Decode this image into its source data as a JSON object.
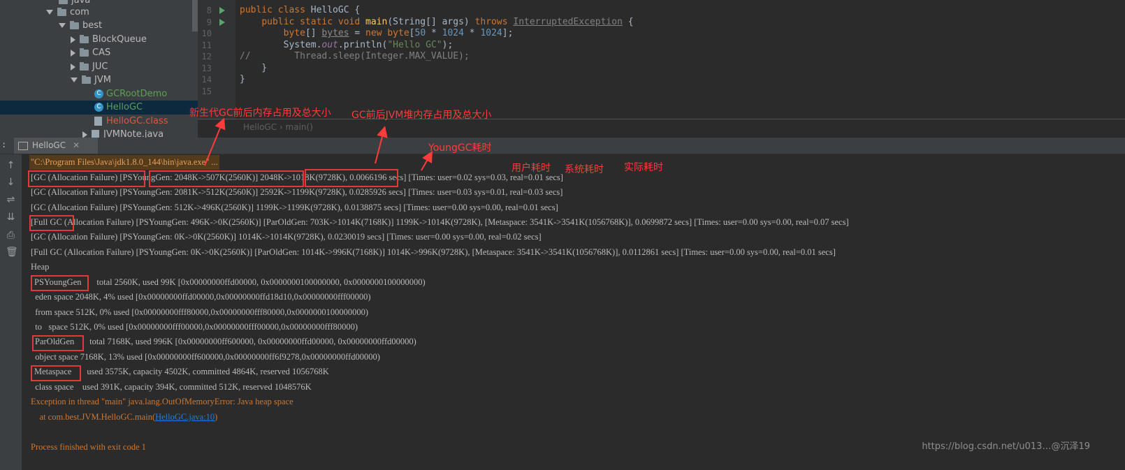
{
  "tree": {
    "items": [
      {
        "label": "java"
      },
      {
        "label": "com"
      },
      {
        "label": "best"
      },
      {
        "label": "BlockQueue"
      },
      {
        "label": "CAS"
      },
      {
        "label": "JUC"
      },
      {
        "label": "JVM"
      },
      {
        "label": "GCRootDemo"
      },
      {
        "label": "HelloGC"
      },
      {
        "label": "HelloGC.class"
      },
      {
        "label": "JVMNote.java"
      }
    ]
  },
  "editor": {
    "line_numbers": [
      "8",
      "9",
      "10",
      "11",
      "12",
      "13",
      "14",
      "15"
    ],
    "breadcrumb": [
      "HelloGC",
      "main()"
    ]
  },
  "tab": {
    "label": "HelloGC"
  },
  "console": {
    "command": "\"C:\\Program Files\\Java\\jdk1.8.0_144\\bin\\java.exe\" ...",
    "lines": [
      "[GC (Allocation Failure) [PSYoungGen: 2048K->507K(2560K)] 2048K->1018K(9728K), 0.0066196 secs] [Times: user=0.02 sys=0.03, real=0.01 secs]",
      "[GC (Allocation Failure) [PSYoungGen: 2081K->512K(2560K)] 2592K->1199K(9728K), 0.0285926 secs] [Times: user=0.03 sys=0.01, real=0.03 secs]",
      "[GC (Allocation Failure) [PSYoungGen: 512K->496K(2560K)] 1199K->1199K(9728K), 0.0138875 secs] [Times: user=0.00 sys=0.00, real=0.01 secs]",
      "[Full GC (Allocation Failure) [PSYoungGen: 496K->0K(2560K)] [ParOldGen: 703K->1014K(7168K)] 1199K->1014K(9728K), [Metaspace: 3541K->3541K(1056768K)], 0.0699872 secs] [Times: user=0.00 sys=0.00, real=0.07 secs]",
      "[GC (Allocation Failure) [PSYoungGen: 0K->0K(2560K)] 1014K->1014K(9728K), 0.0230019 secs] [Times: user=0.00 sys=0.00, real=0.02 secs]",
      "[Full GC (Allocation Failure) [PSYoungGen: 0K->0K(2560K)] [ParOldGen: 1014K->996K(7168K)] 1014K->996K(9728K), [Metaspace: 3541K->3541K(1056768K)], 0.0112861 secs] [Times: user=0.00 sys=0.00, real=0.01 secs]",
      "Heap",
      "PSYoungGen       total 2560K, used 99K [0x00000000ffd00000, 0x0000000100000000, 0x0000000100000000)",
      "  eden space 2048K, 4% used [0x00000000ffd00000,0x00000000ffd18d10,0x00000000fff00000)",
      "  from space 512K, 0% used [0x00000000fff80000,0x00000000fff80000,0x0000000100000000)",
      "  to   space 512K, 0% used [0x00000000fff00000,0x00000000fff00000,0x00000000fff80000)",
      "ParOldGen       total 7168K, used 996K [0x00000000ff600000, 0x00000000ffd00000, 0x00000000ffd00000)",
      "  object space 7168K, 13% used [0x00000000ff600000,0x00000000ff6f9278,0x00000000ffd00000)",
      "Metaspace       used 3575K, capacity 4502K, committed 4864K, reserved 1056768K",
      "  class space    used 391K, capacity 394K, committed 512K, reserved 1048576K"
    ],
    "exception": "Exception in thread \"main\" java.lang.OutOfMemoryError: Java heap space",
    "stack_prefix": "    at com.best.JVM.HelloGC.main(",
    "stack_link": "HelloGC.java:10",
    "stack_suffix": ")",
    "exit": "Process finished with exit code 1"
  },
  "annotations": {
    "young_gen": "新生代GC前后内存占用及总大小",
    "heap": "GC前后JVM堆内存占用及总大小",
    "young_time": "YoungGC耗时",
    "user_time": "用户耗时",
    "sys_time": "系统耗时",
    "real_time": "实际耗时"
  },
  "watermark": "https://blog.csdn.net/u013…@沉泽19"
}
